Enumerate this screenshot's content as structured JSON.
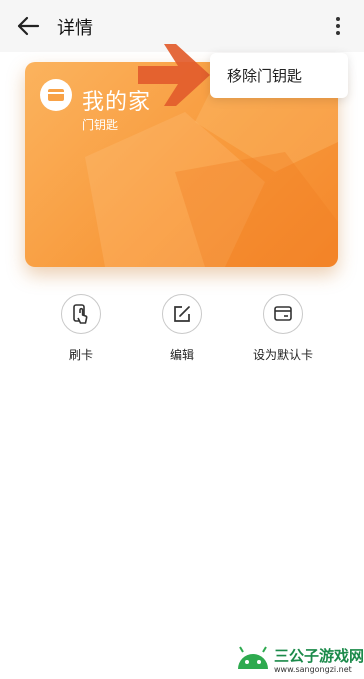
{
  "header": {
    "title": "详情",
    "back_icon": "arrow-left-icon",
    "more_icon": "more-vertical-icon"
  },
  "card": {
    "name": "我的家",
    "subtitle": "门钥匙",
    "icon": "card-icon",
    "accent": "#f89a3c"
  },
  "menu": {
    "items": [
      {
        "label": "移除门钥匙"
      }
    ]
  },
  "arrow": {
    "color": "#e25c2c",
    "icon": "red-arrow-icon"
  },
  "actions": [
    {
      "label": "刷卡",
      "icon": "tap-card-icon"
    },
    {
      "label": "编辑",
      "icon": "edit-icon"
    },
    {
      "label": "设为默认卡",
      "icon": "default-card-icon"
    }
  ],
  "watermark": {
    "brand": "三公子游戏网",
    "url": "www.sangongzi.net"
  }
}
